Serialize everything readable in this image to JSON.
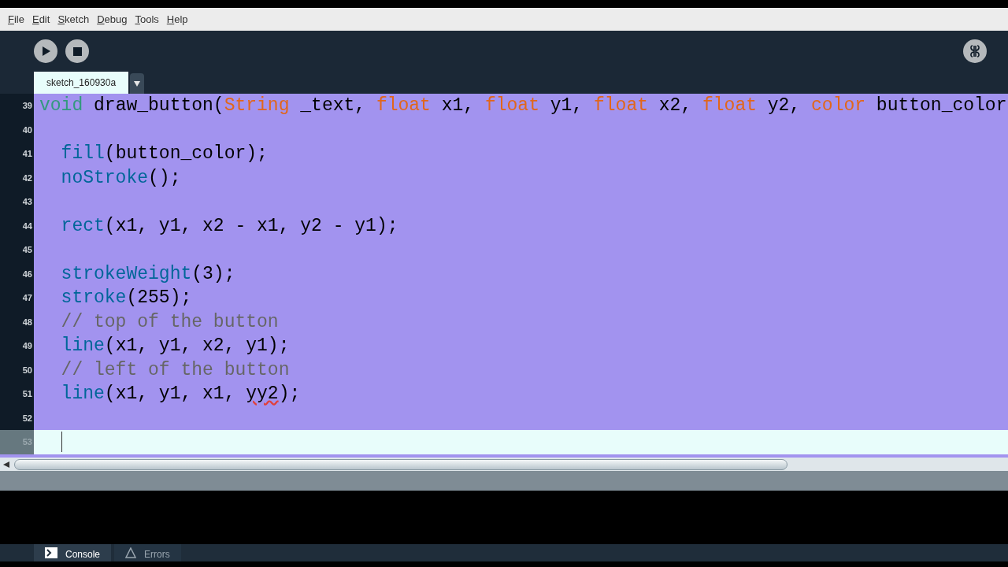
{
  "menu": [
    "File",
    "Edit",
    "Sketch",
    "Debug",
    "Tools",
    "Help"
  ],
  "editor_tabs": [
    {
      "label": "sketch_160930a",
      "selected": true
    }
  ],
  "code_lines": [
    {
      "number": "39",
      "selected": true,
      "tokens": [
        {
          "kind": "keyword",
          "text": "void"
        },
        {
          "kind": "plain",
          "text": " draw_button("
        },
        {
          "kind": "type",
          "text": "String"
        },
        {
          "kind": "plain",
          "text": " _text, "
        },
        {
          "kind": "type",
          "text": "float"
        },
        {
          "kind": "plain",
          "text": " x1, "
        },
        {
          "kind": "type",
          "text": "float"
        },
        {
          "kind": "plain",
          "text": " y1, "
        },
        {
          "kind": "type",
          "text": "float"
        },
        {
          "kind": "plain",
          "text": " x2, "
        },
        {
          "kind": "type",
          "text": "float"
        },
        {
          "kind": "plain",
          "text": " y2, "
        },
        {
          "kind": "type",
          "text": "color"
        },
        {
          "kind": "plain",
          "text": " button_color"
        }
      ]
    },
    {
      "number": "40",
      "selected": true
    },
    {
      "number": "41",
      "selected": true,
      "tokens": [
        {
          "kind": "function",
          "text": "  fill"
        },
        {
          "kind": "plain",
          "text": "(button_color);"
        }
      ]
    },
    {
      "number": "42",
      "selected": true,
      "tokens": [
        {
          "kind": "function",
          "text": "  noStroke"
        },
        {
          "kind": "plain",
          "text": "();"
        }
      ]
    },
    {
      "number": "43",
      "selected": true
    },
    {
      "number": "44",
      "selected": true,
      "tokens": [
        {
          "kind": "function",
          "text": "  rect"
        },
        {
          "kind": "plain",
          "text": "(x1, y1, x2 - x1, y2 - y1);"
        }
      ]
    },
    {
      "number": "45",
      "selected": true
    },
    {
      "number": "46",
      "selected": true,
      "tokens": [
        {
          "kind": "function",
          "text": "  strokeWeight"
        },
        {
          "kind": "plain",
          "text": "(3);"
        }
      ]
    },
    {
      "number": "47",
      "selected": true,
      "tokens": [
        {
          "kind": "function",
          "text": "  stroke"
        },
        {
          "kind": "plain",
          "text": "(255);"
        }
      ]
    },
    {
      "number": "48",
      "selected": true,
      "tokens": [
        {
          "kind": "comment",
          "text": "  // top of the button"
        }
      ]
    },
    {
      "number": "49",
      "selected": true,
      "tokens": [
        {
          "kind": "function",
          "text": "  line"
        },
        {
          "kind": "plain",
          "text": "(x1, y1, x2, y1);"
        }
      ]
    },
    {
      "number": "50",
      "selected": true,
      "tokens": [
        {
          "kind": "comment",
          "text": "  // left of the button"
        }
      ]
    },
    {
      "number": "51",
      "selected": true,
      "tokens": [
        {
          "kind": "function",
          "text": "  line"
        },
        {
          "kind": "plain",
          "text": "(x1, y1, x1, "
        },
        {
          "kind": "error",
          "text": "yy2"
        },
        {
          "kind": "plain",
          "text": ");"
        }
      ]
    },
    {
      "number": "52",
      "selected": true
    },
    {
      "number": "53",
      "selected": false
    }
  ],
  "bottom_tabs": [
    {
      "label": "Console",
      "kind": "console"
    },
    {
      "label": "Errors",
      "kind": "errors"
    }
  ]
}
